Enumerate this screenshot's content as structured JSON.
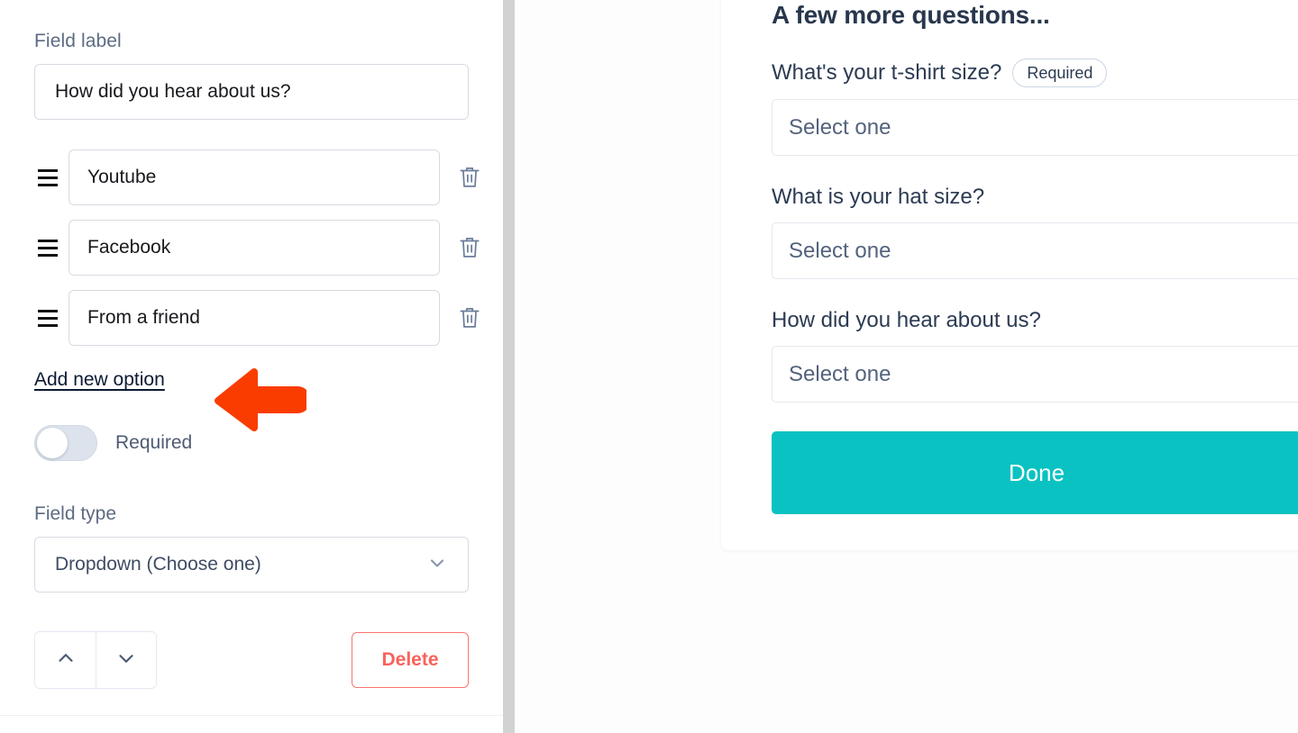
{
  "editor": {
    "field_label_caption": "Field label",
    "field_label_value": "How did you hear about us?",
    "options": [
      {
        "value": "Youtube",
        "drag_icon": "drag-handle-icon",
        "delete_icon": "trash-icon"
      },
      {
        "value": "Facebook",
        "drag_icon": "drag-handle-icon",
        "delete_icon": "trash-icon"
      },
      {
        "value": "From a friend",
        "drag_icon": "drag-handle-icon",
        "delete_icon": "trash-icon"
      }
    ],
    "add_option_label": "Add new option",
    "required_toggle_label": "Required",
    "required_toggle_state": "off",
    "field_type_caption": "Field type",
    "field_type_value": "Dropdown (Choose one)",
    "field_type_chevron": "chevron-down-icon",
    "move_up_icon": "chevron-up-icon",
    "move_down_icon": "chevron-down-icon",
    "delete_label": "Delete"
  },
  "preview": {
    "title": "A few more questions...",
    "questions": [
      {
        "label": "What's your t-shirt size?",
        "required_badge": "Required",
        "placeholder": "Select one"
      },
      {
        "label": "What is your hat size?",
        "required_badge": "",
        "placeholder": "Select one"
      },
      {
        "label": "How did you hear about us?",
        "required_badge": "",
        "placeholder": "Select one"
      }
    ],
    "submit_label": "Done"
  },
  "annotation": {
    "arrow_icon": "left-arrow-annotation-icon",
    "arrow_direction": "left"
  },
  "colors": {
    "accent_teal": "#0ac2c2",
    "delete_red": "#f8635c",
    "annotation_orange": "#fa3c00",
    "text_navy": "#2c3b52",
    "border_grey": "#d6dbe2",
    "scrollbar_grey": "#d2d2d2"
  }
}
